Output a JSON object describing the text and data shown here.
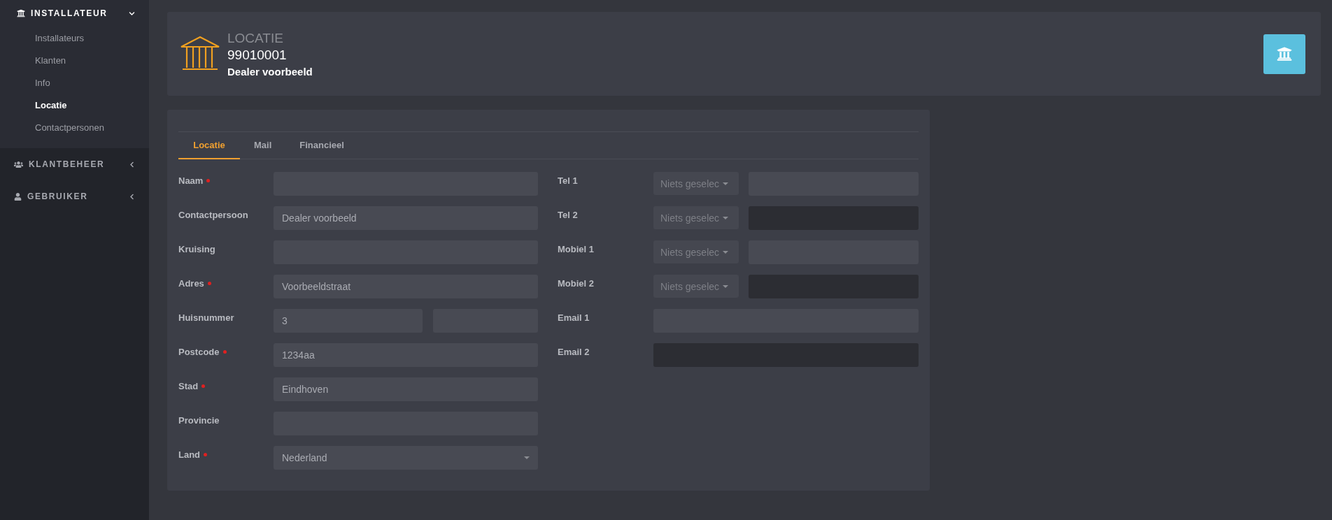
{
  "sidebar": {
    "sections": [
      {
        "kind": "bank",
        "label": "INSTALLATEUR",
        "expanded": true,
        "items": [
          {
            "label": "Installateurs",
            "selected": false
          },
          {
            "label": "Klanten",
            "selected": false
          },
          {
            "label": "Info",
            "selected": false
          },
          {
            "label": "Locatie",
            "selected": true
          },
          {
            "label": "Contactpersonen",
            "selected": false
          }
        ]
      },
      {
        "kind": "users",
        "label": "KLANTBEHEER",
        "expanded": false
      },
      {
        "kind": "user",
        "label": "GEBRUIKER",
        "expanded": false
      }
    ]
  },
  "header": {
    "title": "LOCATIE",
    "number": "99010001",
    "subtitle": "Dealer voorbeeld"
  },
  "tabs": [
    {
      "label": "Locatie",
      "selected": true
    },
    {
      "label": "Mail",
      "selected": false
    },
    {
      "label": "Financieel",
      "selected": false
    }
  ],
  "left_fields": [
    {
      "kind": "text",
      "label": "Naam",
      "required": true
    },
    {
      "kind": "text",
      "label": "Contactpersoon",
      "required": false,
      "value": "Dealer voorbeeld"
    },
    {
      "kind": "text",
      "label": "Kruising",
      "required": false
    },
    {
      "kind": "text",
      "label": "Adres",
      "required": true,
      "value": "Voorbeeldstraat"
    },
    {
      "kind": "split",
      "label": "Huisnummer",
      "required": false,
      "value": "3"
    },
    {
      "kind": "text",
      "label": "Postcode",
      "required": true,
      "value": "1234aa"
    },
    {
      "kind": "text",
      "label": "Stad",
      "required": true,
      "value": "Eindhoven"
    },
    {
      "kind": "text",
      "label": "Provincie",
      "required": false
    },
    {
      "kind": "select",
      "label": "Land",
      "required": true,
      "value": "Nederland"
    }
  ],
  "right_fields": [
    {
      "kind": "phone",
      "label": "Tel 1",
      "select": "Niets geselec",
      "disabled": false
    },
    {
      "kind": "phone",
      "label": "Tel 2",
      "select": "Niets geselec",
      "disabled": true
    },
    {
      "kind": "phone",
      "label": "Mobiel 1",
      "select": "Niets geselec",
      "disabled": false
    },
    {
      "kind": "phone",
      "label": "Mobiel 2",
      "select": "Niets geselec",
      "disabled": true
    },
    {
      "kind": "text",
      "label": "Email 1",
      "disabled": false
    },
    {
      "kind": "text",
      "label": "Email 2",
      "disabled": true
    }
  ]
}
